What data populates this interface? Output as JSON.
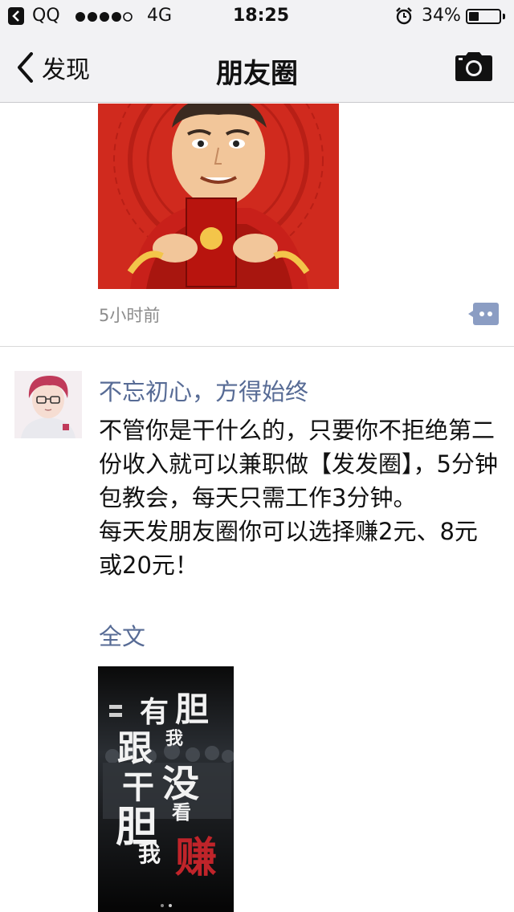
{
  "status_bar": {
    "back_app": "QQ",
    "network": "4G",
    "time": "18:25",
    "battery_pct": "34%",
    "battery_level": 0.34,
    "signal_dots_filled": 4,
    "signal_dots_total": 5
  },
  "nav": {
    "back_label": "发现",
    "title": "朋友圈"
  },
  "feed": {
    "first_post": {
      "timestamp": "5小时前"
    },
    "second_post": {
      "username": "不忘初心，方得始终",
      "text": "不管你是干什么的，只要你不拒绝第二份收入就可以兼职做【发发圈】，5分钟包教会，每天只需工作3分钟。\n每天发朋友圈你可以选择赚2元、8元或20元！",
      "full_text_link": "全文",
      "poster_words": {
        "you": "有",
        "dan_top": "胆",
        "wo_top": "我",
        "gen": "跟",
        "mei": "没",
        "gan": "干",
        "kan": "看",
        "dan_big": "胆",
        "wo_bottom": "我",
        "zhuan": "赚"
      }
    }
  },
  "colors": {
    "link": "#576b95",
    "nav_bg": "#f2f2f4",
    "poster_red": "#c0242a",
    "festive_red": "#d02a1e"
  }
}
